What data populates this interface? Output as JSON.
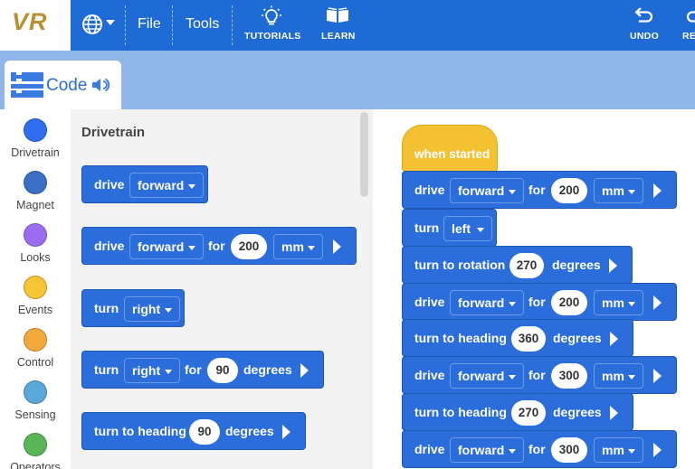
{
  "topbar": {
    "logo": "VR",
    "file_label": "File",
    "tools_label": "Tools",
    "tutorials_label": "TUTORIALS",
    "learn_label": "LEARN",
    "undo_label": "UNDO",
    "redo_label": "RE",
    "globe_icon": "globe-icon",
    "colors": {
      "bar": "#1e6bd6",
      "logo_text": "#b8912e"
    }
  },
  "code_tab": {
    "label": "Code"
  },
  "categories": [
    {
      "label": "Drivetrain",
      "color": "#2f6ef0"
    },
    {
      "label": "Magnet",
      "color": "#3b6fc6"
    },
    {
      "label": "Looks",
      "color": "#9b6cf0"
    },
    {
      "label": "Events",
      "color": "#f5c536"
    },
    {
      "label": "Control",
      "color": "#f3a93a"
    },
    {
      "label": "Sensing",
      "color": "#5aa7da"
    },
    {
      "label": "Operators",
      "color": "#5ab556"
    }
  ],
  "palette": {
    "title": "Drivetrain",
    "blocks": [
      {
        "kw": "drive",
        "dir": "forward"
      },
      {
        "kw": "drive",
        "dir": "forward",
        "for": "for",
        "val": "200",
        "unit": "mm"
      },
      {
        "kw": "turn",
        "dir": "right"
      },
      {
        "kw": "turn",
        "dir": "right",
        "for": "for",
        "val": "90",
        "unit": "degrees"
      },
      {
        "kw": "turn to heading",
        "val": "90",
        "unit": "degrees"
      }
    ]
  },
  "workspace": {
    "hat": "when started",
    "blocks": [
      {
        "kw": "drive",
        "dir": "forward",
        "for": "for",
        "val": "200",
        "unit": "mm"
      },
      {
        "kw": "turn",
        "dir": "left"
      },
      {
        "kw": "turn to rotation",
        "val": "270",
        "unit": "degrees"
      },
      {
        "kw": "drive",
        "dir": "forward",
        "for": "for",
        "val": "200",
        "unit": "mm"
      },
      {
        "kw": "turn to heading",
        "val": "360",
        "unit": "degrees"
      },
      {
        "kw": "drive",
        "dir": "forward",
        "for": "for",
        "val": "300",
        "unit": "mm"
      },
      {
        "kw": "turn to heading",
        "val": "270",
        "unit": "degrees"
      },
      {
        "kw": "drive",
        "dir": "forward",
        "for": "for",
        "val": "300",
        "unit": "mm"
      }
    ],
    "block_color": "#2a6ddb",
    "hat_color": "#f4c132"
  }
}
